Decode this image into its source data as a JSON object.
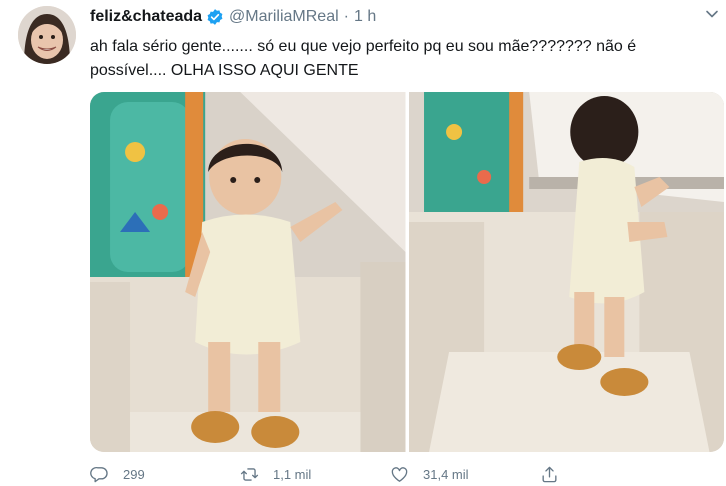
{
  "tweet": {
    "display_name": "feliz&chateada",
    "handle": "@MariliaMReal",
    "separator": "·",
    "time": "1 h",
    "text": "ah fala sério gente....... só eu que vejo perfeito pq eu sou mãe??????? não é possível.... OLHA ISSO AQUI GENTE"
  },
  "actions": {
    "reply_count": "299",
    "retweet_count": "1,1 mil",
    "like_count": "31,4 mil"
  },
  "icons": {
    "verified": "verified-badge-icon",
    "caret": "chevron-down-icon",
    "reply": "reply-icon",
    "retweet": "retweet-icon",
    "like": "heart-icon",
    "share": "share-icon"
  },
  "colors": {
    "verified_blue": "#1da1f2",
    "secondary_text": "#657786"
  }
}
